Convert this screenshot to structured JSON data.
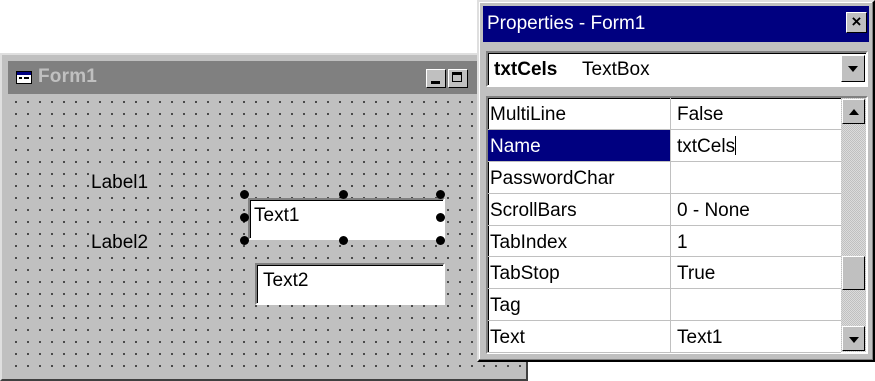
{
  "form_window": {
    "title": "Form1",
    "icon": "form-icon",
    "buttons": [
      "minimize",
      "maximize"
    ],
    "labels": [
      "Label1",
      "Label2"
    ],
    "textboxes": [
      {
        "text": "Text1",
        "selected": true
      },
      {
        "text": "Text2",
        "selected": false
      }
    ]
  },
  "properties_window": {
    "title": "Properties - Form1",
    "close_label": "×",
    "object_name": "txtCels",
    "object_type": "TextBox",
    "selected_property": "Name",
    "rows": [
      {
        "name": "MultiLine",
        "value": "False"
      },
      {
        "name": "Name",
        "value": "txtCels"
      },
      {
        "name": "PasswordChar",
        "value": ""
      },
      {
        "name": "ScrollBars",
        "value": "0 - None"
      },
      {
        "name": "TabIndex",
        "value": "1"
      },
      {
        "name": "TabStop",
        "value": "True"
      },
      {
        "name": "Tag",
        "value": ""
      },
      {
        "name": "Text",
        "value": "Text1"
      }
    ]
  },
  "colors": {
    "active_title": "#000080",
    "inactive_title": "#808080",
    "face": "#c0c0c0"
  }
}
